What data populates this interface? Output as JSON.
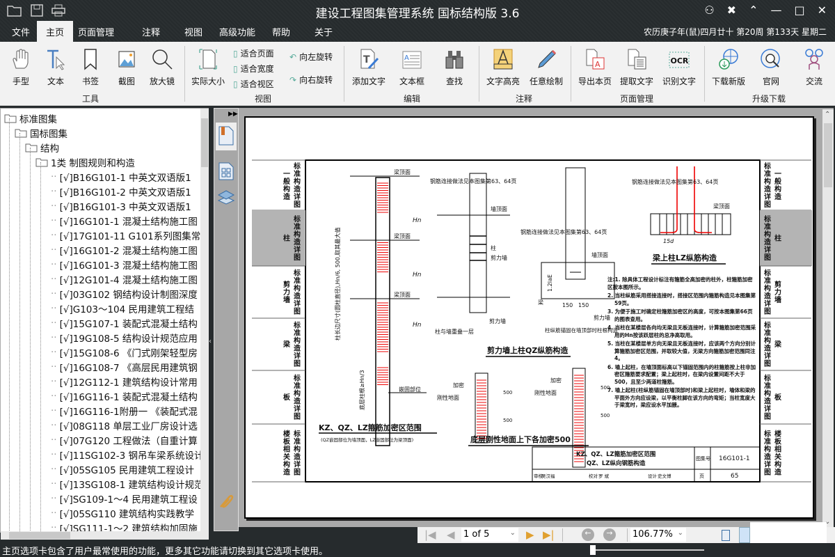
{
  "app": {
    "title": "建设工程图集管理系统  国标结构版 3.6",
    "date_info": "农历庚子年(鼠)四月廿十 第20周 第133天 星期二"
  },
  "menu": [
    "文件",
    "主页",
    "页面管理",
    "注释",
    "视图",
    "高级功能",
    "帮助",
    "关于"
  ],
  "ribbon": {
    "tools": [
      "手型",
      "文本",
      "书签",
      "截图",
      "放大镜"
    ],
    "actual_size": "实际大小",
    "fit": [
      "适合页面",
      "适合宽度",
      "适合视区"
    ],
    "rotate": [
      "向左旋转",
      "向右旋转"
    ],
    "edit": [
      "添加文字",
      "文本框",
      "查找"
    ],
    "annot": [
      "文字高亮",
      "任意绘制"
    ],
    "pages": [
      "导出本页",
      "提取文字",
      "识别文字"
    ],
    "upgrade": [
      "下载新版",
      "官网",
      "交流"
    ],
    "groups": [
      "工具",
      "视图",
      "编辑",
      "注释",
      "页面管理",
      "升级下载"
    ]
  },
  "tree": {
    "folders": [
      "标准图集",
      "国标图集",
      "结构",
      "1类 制图规则和构造"
    ],
    "items": [
      "[√]B16G101-1 中英文双语版1",
      "[√]B16G101-2 中英文双语版1",
      "[√]B16G101-3 中英文双语版1",
      "[√]16G101-1 混凝土结构施工图",
      "[√]17G101-11 G101系列图集常",
      "[√]16G101-2 混凝土结构施工图",
      "[√]16G101-3 混凝土结构施工图",
      "[√]12G101-4 混凝土结构施工图",
      "[√]03G102 钢结构设计制图深度",
      "[√]G103～104 民用建筑工程结",
      "[√]15G107-1 装配式混凝土结构",
      "[√]19G108-5 结构设计规范应用",
      "[√]15G108-6 《门式刚架轻型房",
      "[√]16G108-7 《高层民用建筑钢",
      "[√]12G112-1 建筑结构设计常用",
      "[√]16G116-1 装配式混凝土结构",
      "[√]16G116-1附册一 《装配式混",
      "[√]08G118 单层工业厂房设计选",
      "[√]07G120 工程做法（自重计算",
      "[√]11SG102-3 钢吊车梁系统设计",
      "[√]05SG105 民用建筑工程设计",
      "[√]13SG108-1 建筑结构设计规范",
      "[√]SG109-1～4 民用建筑工程设",
      "[√]05SG110 建筑结构实践教学",
      "[√]SG111-1～2 建筑结构加固施"
    ]
  },
  "navbar": {
    "page": "1 of 5",
    "zoom": "106.77%"
  },
  "status": "主页选项卡包含了用户最常使用的功能，更多其它功能请切换到其它选项卡使用。",
  "document": {
    "side_tabs": [
      {
        "l": "标准构造详图",
        "r": "一般构造"
      },
      {
        "l": "标准构造详图",
        "r": "柱"
      },
      {
        "l": "标准构造详图",
        "r": "剪力墙"
      },
      {
        "l": "标准构造详图",
        "r": "梁"
      },
      {
        "l": "标准构造详图",
        "r": "板"
      },
      {
        "l": "标准构造详图",
        "r": "楼板相关构造"
      }
    ],
    "active_tab_color": "#b4b4b4",
    "caption1": "KZ、QZ、LZ箍筋加密区范围",
    "caption1_sub": "(QZ嵌固部位为墙顶面，LZ嵌固部位为梁顶面)",
    "caption2": "剪力墙上柱QZ纵筋构造",
    "caption3": "梁上柱LZ纵筋构造",
    "caption4": "底层刚性地面上下各加密500",
    "labels": {
      "beam_top": "梁顶面",
      "wall_top": "墙顶面",
      "column": "柱",
      "shear_wall": "剪力墙",
      "rebar_note": "钢筋连接做法见本图集第63、64页",
      "overlap": "柱与墙重叠一层",
      "anchor": "柱纵筋锚固在墙顶部时柱根构造",
      "embed": "嵌固部位",
      "dense": "加密",
      "rigid": "刚性地面",
      "dim500": "500",
      "dim150": "150",
      "d15": "15d",
      "hn": "Hn",
      "side_dim": "柱长边尺寸(圆柱直径),Hn/6, 500,取其最大值",
      "bottom_dim": "底层柱根≥Hn/3",
      "lae": "1.2laE",
      "beam": "梁"
    },
    "notes": [
      "注:1. 除具体工程设计标注有箍筋全高加密的柱外，柱箍筋加密区按本图所示。",
      "2. 当柱纵筋采用搭接连接时，搭接区范围内箍筋构造见本图集第59页。",
      "3. 为便于施工时确定柱箍筋加密区的高度，可按本图集第66页的图表查用。",
      "4. 当柱在某楼层各向均无梁且无板连接时，计算箍筋加密范围采用的Hn按该跃层柱的总净高取用。",
      "5. 当柱在某楼层单方向无梁且无板连接时，应该两个方向分别计算箍筋加密区范围，并取较大值，无梁方向箍筋加密范围同注4。",
      "6. 墙上起柱，在墙顶面标高以下锚固范围内的柱箍筋按上柱非加密区箍筋要求配置；梁上起柱时，在梁内设置间距不大于500，且至少两道柱箍筋。",
      "7. 墙上起柱(柱纵筋锚固在墙顶部时)和梁上起柱时，墙体和梁的平面外方向应设梁，以平衡柱脚在该方向的弯矩；当柱宽度大于梁宽时，梁应设水平加腋。"
    ],
    "titleblock": {
      "title1": "KZ、QZ、LZ箍筋加密区范围",
      "title2": "QZ、LZ纵向钢筋构造",
      "atlas_label": "图集号",
      "atlas_no": "16G101-1",
      "page_label": "页",
      "page_no": "65",
      "review": "审核",
      "reviewer": "吴汉福",
      "check": "校对",
      "checker": "罗 斌",
      "design": "设计",
      "designer": "史文博"
    }
  }
}
